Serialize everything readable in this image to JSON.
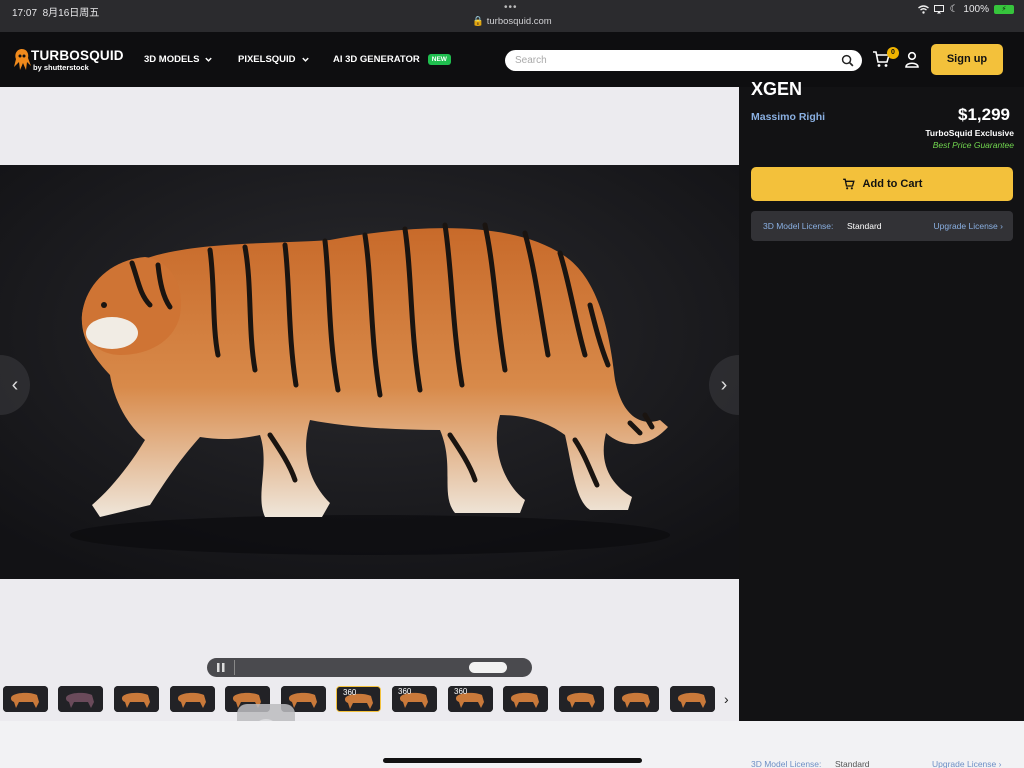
{
  "status_bar": {
    "time": "17:07",
    "date": "8月16日周五",
    "url": "turbosquid.com",
    "battery": "100%"
  },
  "header": {
    "logo_word": "TURBOSQUID",
    "logo_sub": "by shutterstock",
    "nav": [
      {
        "label": "3D MODELS"
      },
      {
        "label": "PIXELSQUID"
      },
      {
        "label": "AI 3D GENERATOR",
        "badge": "NEW"
      }
    ],
    "search_placeholder": "Search",
    "cart_count": "0",
    "signup_label": "Sign up"
  },
  "product": {
    "title_fragment": "XGEN",
    "author": "Massimo Righi",
    "price": "$1,299",
    "exclusive": "TurboSquid Exclusive",
    "guarantee": "Best Price Guarantee",
    "add_to_cart": "Add to Cart",
    "license_label": "3D Model License:",
    "license_value": "Standard",
    "upgrade_license": "Upgrade License"
  },
  "viewer": {
    "thumbnails": [
      {
        "badge": ""
      },
      {
        "badge": ""
      },
      {
        "badge": ""
      },
      {
        "badge": ""
      },
      {
        "badge": ""
      },
      {
        "badge": ""
      },
      {
        "badge": "360"
      },
      {
        "badge": "360"
      },
      {
        "badge": "360"
      },
      {
        "badge": ""
      },
      {
        "badge": ""
      },
      {
        "badge": ""
      },
      {
        "badge": ""
      }
    ],
    "selected_thumbnail": 6
  },
  "bottom_ghost": {
    "license_label": "3D Model License:",
    "license_value": "Standard",
    "upgrade_license": "Upgrade License"
  },
  "colors": {
    "accent": "#f3c13b",
    "link": "#8ab0e2",
    "guarantee": "#71d64f",
    "panel_bg": "#121214"
  }
}
